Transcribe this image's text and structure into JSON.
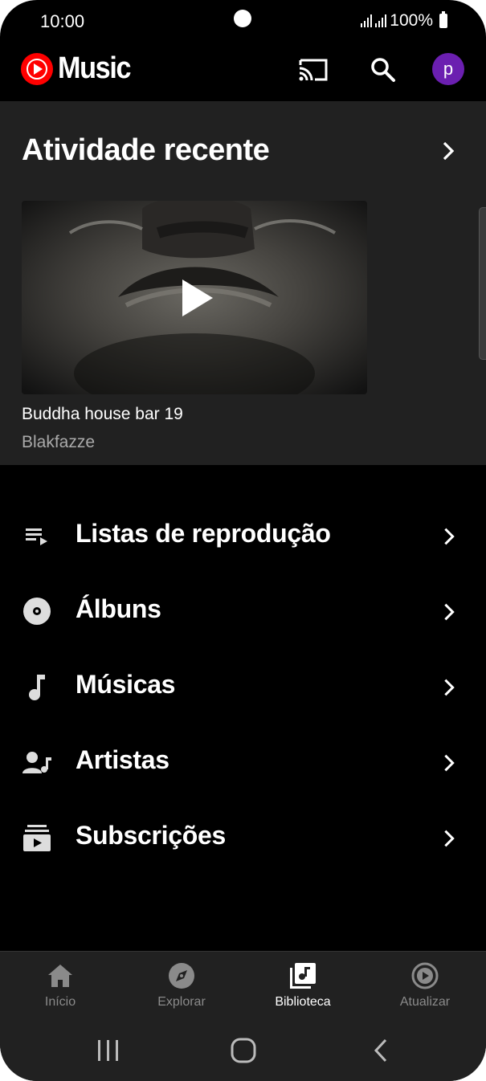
{
  "status_bar": {
    "time": "10:00",
    "battery": "100%"
  },
  "app_bar": {
    "logo_text": "Music",
    "avatar_letter": "p"
  },
  "recent_activity": {
    "title": "Atividade recente",
    "item": {
      "title": "Buddha house bar 19",
      "artist": "Blakfazze"
    }
  },
  "library": {
    "items": [
      {
        "label": "Listas de reprodução",
        "icon": "playlist-icon"
      },
      {
        "label": "Álbuns",
        "icon": "album-icon"
      },
      {
        "label": "Músicas",
        "icon": "music-note-icon"
      },
      {
        "label": "Artistas",
        "icon": "artist-icon"
      },
      {
        "label": "Subscrições",
        "icon": "subscriptions-icon"
      }
    ]
  },
  "bottom_nav": {
    "items": [
      {
        "label": "Início",
        "icon": "home-icon",
        "active": false
      },
      {
        "label": "Explorar",
        "icon": "compass-icon",
        "active": false
      },
      {
        "label": "Biblioteca",
        "icon": "library-icon",
        "active": true
      },
      {
        "label": "Atualizar",
        "icon": "upgrade-icon",
        "active": false
      }
    ]
  },
  "colors": {
    "background": "#000000",
    "card": "#212121",
    "brand_red": "#ff0000",
    "avatar": "#6b1fb0",
    "muted_text": "#aaaaaa"
  }
}
